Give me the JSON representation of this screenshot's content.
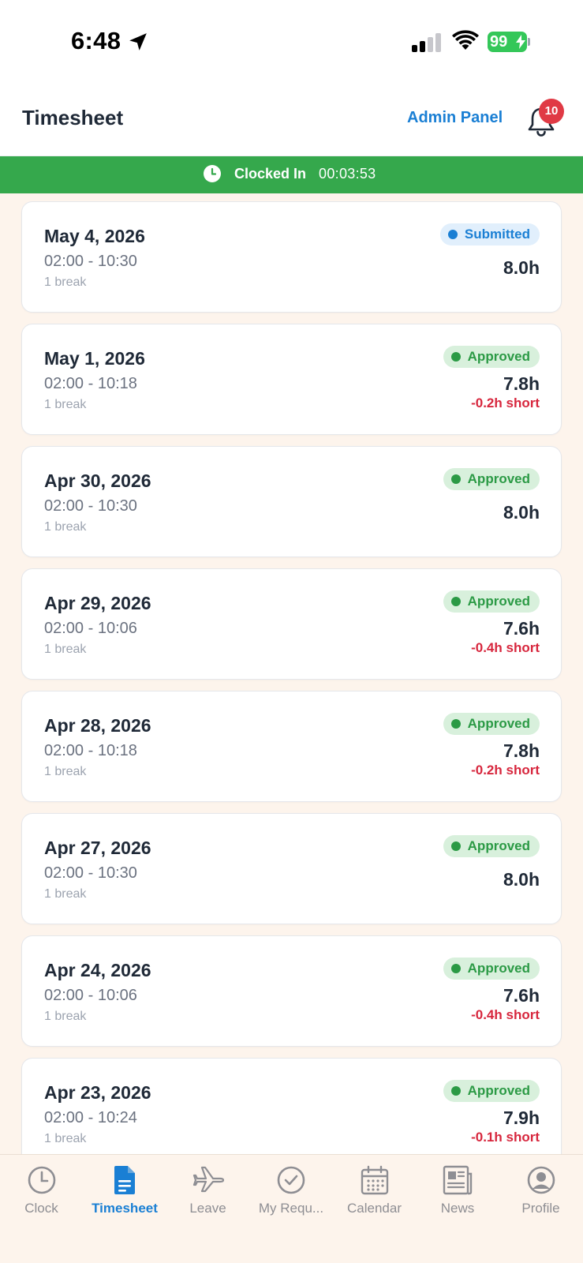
{
  "status_bar": {
    "time": "6:48",
    "battery": "99"
  },
  "header": {
    "title": "Timesheet",
    "admin_label": "Admin Panel",
    "notification_count": "10"
  },
  "clock_banner": {
    "label": "Clocked In",
    "elapsed": "00:03:53"
  },
  "entries": [
    {
      "date": "May 4, 2026",
      "range": "02:00 - 10:30",
      "breaks": "1 break",
      "status": "Submitted",
      "hours": "8.0h",
      "short": ""
    },
    {
      "date": "May 1, 2026",
      "range": "02:00 - 10:18",
      "breaks": "1 break",
      "status": "Approved",
      "hours": "7.8h",
      "short": "-0.2h short"
    },
    {
      "date": "Apr 30, 2026",
      "range": "02:00 - 10:30",
      "breaks": "1 break",
      "status": "Approved",
      "hours": "8.0h",
      "short": ""
    },
    {
      "date": "Apr 29, 2026",
      "range": "02:00 - 10:06",
      "breaks": "1 break",
      "status": "Approved",
      "hours": "7.6h",
      "short": "-0.4h short"
    },
    {
      "date": "Apr 28, 2026",
      "range": "02:00 - 10:18",
      "breaks": "1 break",
      "status": "Approved",
      "hours": "7.8h",
      "short": "-0.2h short"
    },
    {
      "date": "Apr 27, 2026",
      "range": "02:00 - 10:30",
      "breaks": "1 break",
      "status": "Approved",
      "hours": "8.0h",
      "short": ""
    },
    {
      "date": "Apr 24, 2026",
      "range": "02:00 - 10:06",
      "breaks": "1 break",
      "status": "Approved",
      "hours": "7.6h",
      "short": "-0.4h short"
    },
    {
      "date": "Apr 23, 2026",
      "range": "02:00 - 10:24",
      "breaks": "1 break",
      "status": "Approved",
      "hours": "7.9h",
      "short": "-0.1h short"
    }
  ],
  "tabs": [
    {
      "label": "Clock",
      "icon": "clock-icon",
      "active": false
    },
    {
      "label": "Timesheet",
      "icon": "document-icon",
      "active": true
    },
    {
      "label": "Leave",
      "icon": "airplane-icon",
      "active": false
    },
    {
      "label": "My Requ...",
      "icon": "check-circle-icon",
      "active": false
    },
    {
      "label": "Calendar",
      "icon": "calendar-icon",
      "active": false
    },
    {
      "label": "News",
      "icon": "newspaper-icon",
      "active": false
    },
    {
      "label": "Profile",
      "icon": "profile-icon",
      "active": false
    }
  ],
  "colors": {
    "accent": "#1a7fd4",
    "banner": "#35a84c",
    "approved": "#2b9a45",
    "short": "#d7263d",
    "background": "#fdf4ec"
  }
}
